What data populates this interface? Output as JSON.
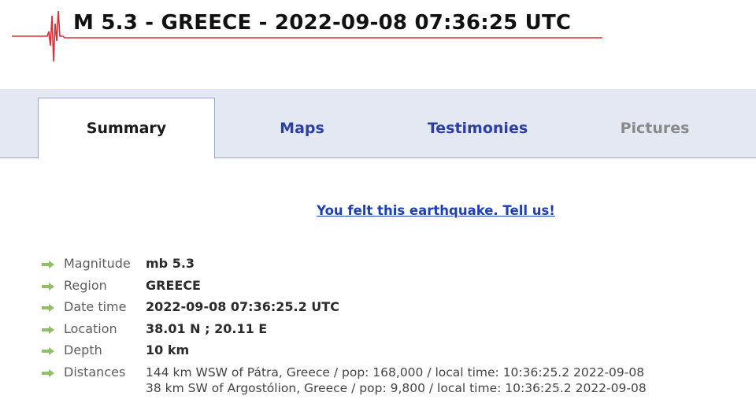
{
  "header": {
    "title": "M 5.3 - GREECE - 2022-09-08 07:36:25 UTC"
  },
  "tabs": [
    {
      "label": "Summary",
      "state": "active"
    },
    {
      "label": "Maps",
      "state": "link"
    },
    {
      "label": "Testimonies",
      "state": "link"
    },
    {
      "label": "Pictures",
      "state": "disabled"
    }
  ],
  "felt_link": "You felt this earthquake. Tell us!",
  "details": {
    "magnitude": {
      "label": "Magnitude",
      "value": "mb 5.3"
    },
    "region": {
      "label": "Region",
      "value": "GREECE"
    },
    "datetime": {
      "label": "Date time",
      "value": "2022-09-08 07:36:25.2 UTC"
    },
    "location": {
      "label": "Location",
      "value": "38.01 N ; 20.11 E"
    },
    "depth": {
      "label": "Depth",
      "value": "10 km"
    },
    "distances": {
      "label": "Distances",
      "lines": [
        "144 km WSW of Pátra, Greece / pop: 168,000 / local time: 10:36:25.2 2022-09-08",
        "38 km SW of Argostólion, Greece / pop: 9,800 / local time: 10:36:25.2 2022-09-08"
      ]
    }
  },
  "colors": {
    "seismogram": "#d8303a",
    "arrow": "#8fc066",
    "tab_link": "#2c3ea8",
    "tab_bar": "#e3e8f3"
  },
  "icons": {
    "logo": "seismogram-logo-icon",
    "bullet": "arrow-right-icon"
  }
}
